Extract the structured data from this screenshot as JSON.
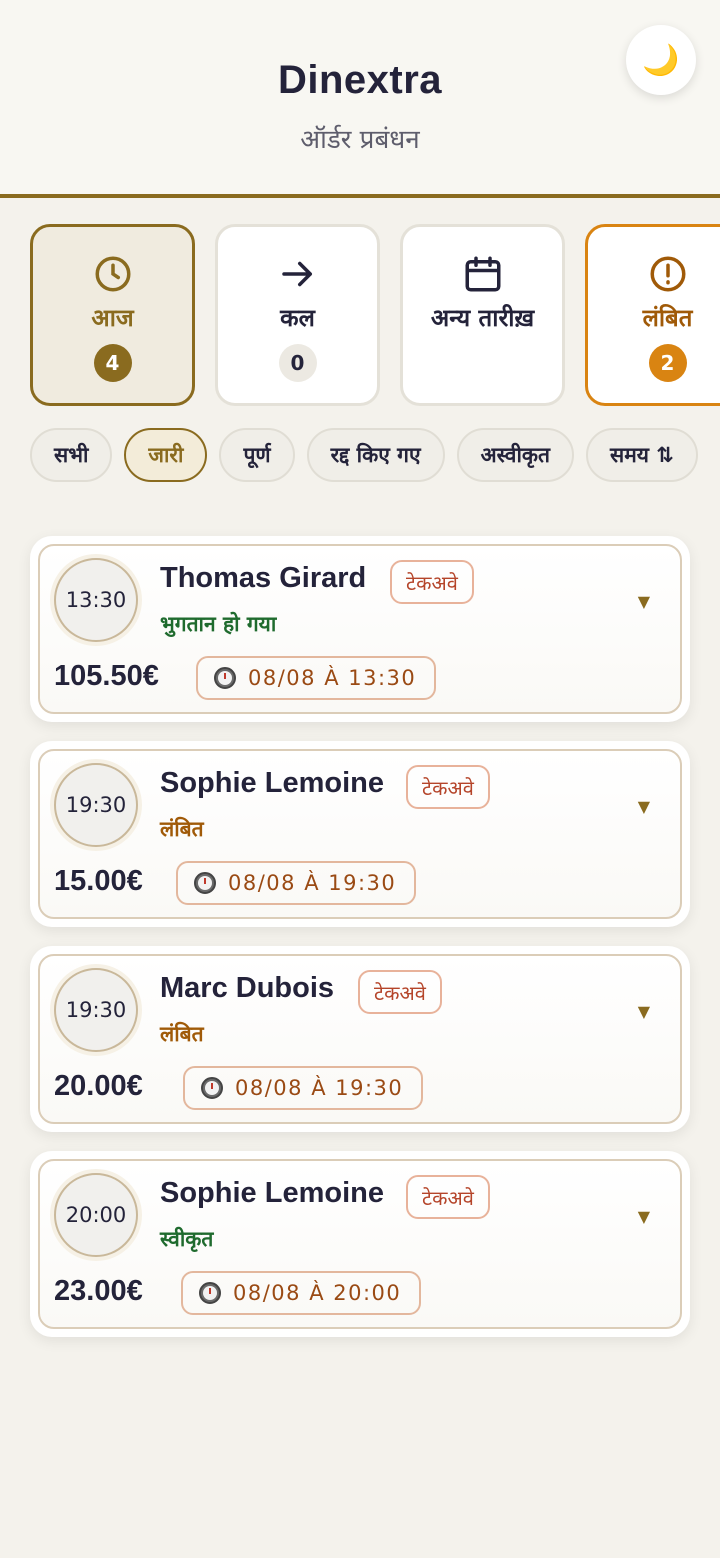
{
  "header": {
    "title": "Dinextra",
    "subtitle": "ऑर्डर प्रबंधन",
    "theme_icon": "moon-icon"
  },
  "day_tiles": [
    {
      "label": "आज",
      "count": "4",
      "icon": "clock-icon",
      "state": "active"
    },
    {
      "label": "कल",
      "count": "0",
      "icon": "arrow-right-icon",
      "state": "default"
    },
    {
      "label": "अन्य तारीख़",
      "count": "",
      "icon": "calendar-icon",
      "state": "default"
    },
    {
      "label": "लंबित",
      "count": "2",
      "icon": "alert-circle-icon",
      "state": "pending"
    }
  ],
  "filters": [
    {
      "label": "सभी",
      "active": false
    },
    {
      "label": "जारी",
      "active": true
    },
    {
      "label": "पूर्ण",
      "active": false
    },
    {
      "label": "रद्द किए गए",
      "active": false
    },
    {
      "label": "अस्वीकृत",
      "active": false
    },
    {
      "label": "समय ⇅",
      "active": false
    }
  ],
  "orders": [
    {
      "time": "13:30",
      "customer": "Thomas Girard",
      "type": "टेकअवे",
      "status": "भुगतान हो गया",
      "status_color": "#1f6b2e",
      "price": "105.50€",
      "datetime": "08/08 À 13:30"
    },
    {
      "time": "19:30",
      "customer": "Sophie Lemoine",
      "type": "टेकअवे",
      "status": "लंबित",
      "status_color": "#a05a08",
      "price": "15.00€",
      "datetime": "08/08 À 19:30"
    },
    {
      "time": "19:30",
      "customer": "Marc Dubois",
      "type": "टेकअवे",
      "status": "लंबित",
      "status_color": "#a05a08",
      "price": "20.00€",
      "datetime": "08/08 À 19:30"
    },
    {
      "time": "20:00",
      "customer": "Sophie Lemoine",
      "type": "टेकअवे",
      "status": "स्वीकृत",
      "status_color": "#1f6b2e",
      "price": "23.00€",
      "datetime": "08/08 À 20:00"
    }
  ],
  "colors": {
    "accent": "#8a6b1f",
    "pending": "#d98412",
    "paid": "#1f6b2e"
  }
}
